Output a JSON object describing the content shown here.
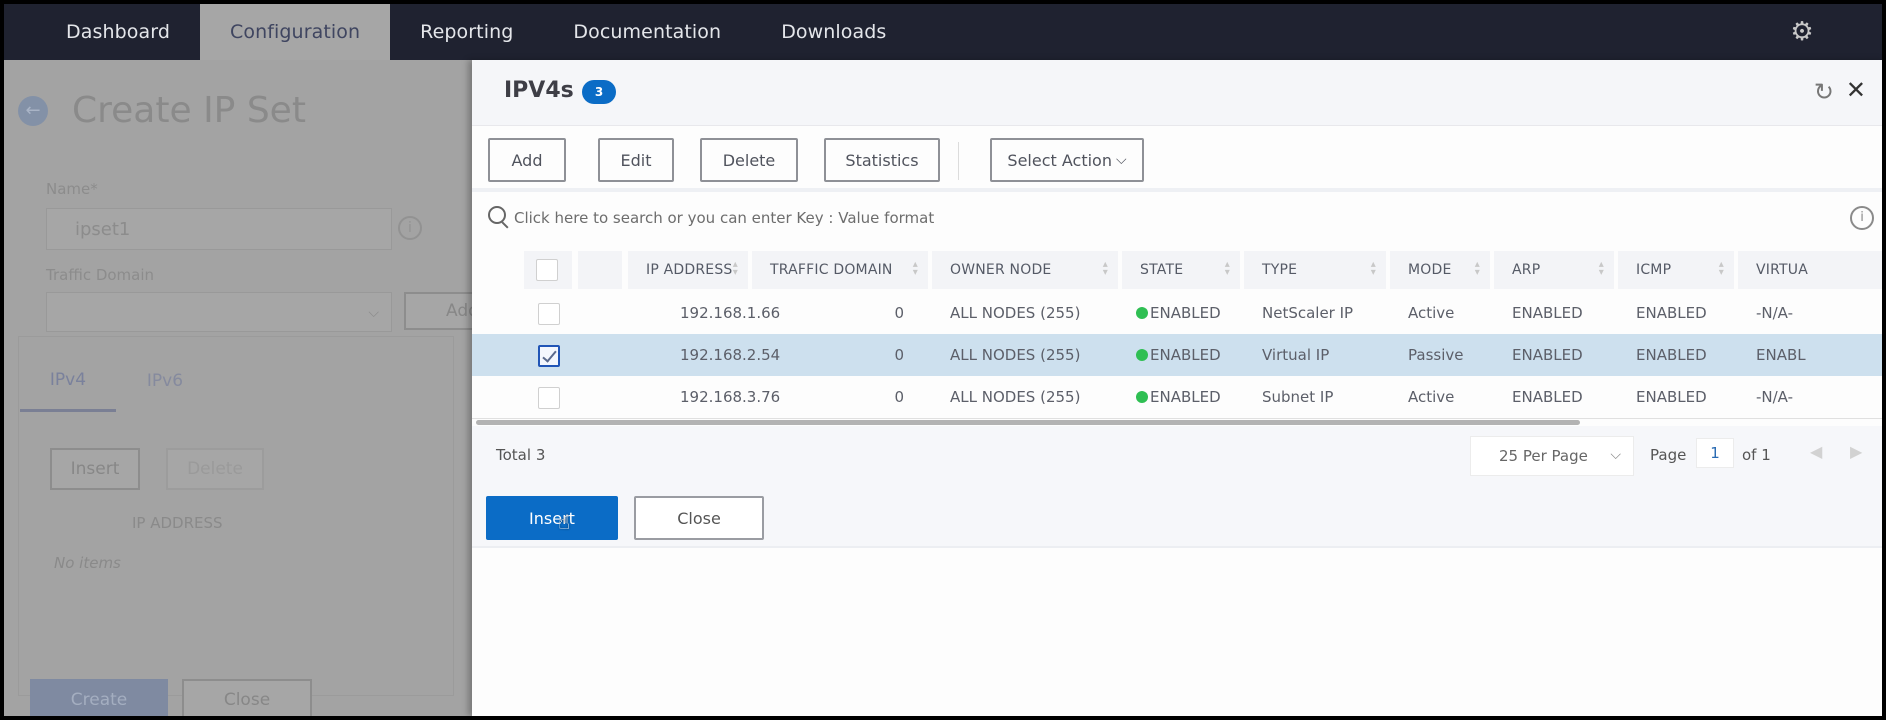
{
  "nav": {
    "tabs": [
      {
        "label": "Dashboard",
        "active": false
      },
      {
        "label": "Configuration",
        "active": true
      },
      {
        "label": "Reporting",
        "active": false
      },
      {
        "label": "Documentation",
        "active": false
      },
      {
        "label": "Downloads",
        "active": false
      }
    ],
    "settings_icon": "gear-icon"
  },
  "background_page": {
    "title": "Create IP Set",
    "back_icon": "arrow-left-icon",
    "name_label": "Name*",
    "name_value": "ipset1",
    "traffic_domain_label": "Traffic Domain",
    "traffic_domain_value": "",
    "add_button": "Add",
    "tabs": [
      {
        "label": "IPv4",
        "active": true
      },
      {
        "label": "IPv6",
        "active": false
      }
    ],
    "insert_button": "Insert",
    "delete_button": "Delete",
    "column_header": "IP ADDRESS",
    "empty_text": "No items",
    "create_button": "Create",
    "close_button": "Close"
  },
  "panel": {
    "title": "IPV4s",
    "count": "3",
    "refresh_icon": "refresh-icon",
    "close_icon": "close-icon",
    "toolbar": {
      "add": "Add",
      "edit": "Edit",
      "delete": "Delete",
      "statistics": "Statistics",
      "select_action": "Select Action"
    },
    "search_placeholder": "Click here to search or you can enter Key : Value format",
    "columns": [
      "IP ADDRESS",
      "TRAFFIC DOMAIN",
      "OWNER NODE",
      "STATE",
      "TYPE",
      "MODE",
      "ARP",
      "ICMP",
      "VIRTUA"
    ],
    "rows": [
      {
        "selected": false,
        "ip": "192.168.1.66",
        "traffic_domain": "0",
        "owner_node": "ALL NODES (255)",
        "state": "ENABLED",
        "type": "NetScaler IP",
        "mode": "Active",
        "arp": "ENABLED",
        "icmp": "ENABLED",
        "virtual": "-N/A-"
      },
      {
        "selected": true,
        "ip": "192.168.2.54",
        "traffic_domain": "0",
        "owner_node": "ALL NODES (255)",
        "state": "ENABLED",
        "type": "Virtual IP",
        "mode": "Passive",
        "arp": "ENABLED",
        "icmp": "ENABLED",
        "virtual": "ENABL"
      },
      {
        "selected": false,
        "ip": "192.168.3.76",
        "traffic_domain": "0",
        "owner_node": "ALL NODES (255)",
        "state": "ENABLED",
        "type": "Subnet IP",
        "mode": "Active",
        "arp": "ENABLED",
        "icmp": "ENABLED",
        "virtual": "-N/A-"
      }
    ],
    "footer": {
      "total_label": "Total",
      "total_value": "3",
      "per_page": "25 Per Page",
      "page_label": "Page",
      "page_value": "1",
      "page_of": "of 1"
    },
    "insert_button": "Insert",
    "close_button": "Close"
  },
  "colors": {
    "primary": "#0b6cc6",
    "nav_bg": "#1f2230",
    "selected_row": "#cde0ee",
    "status_enabled": "#2fbf53"
  }
}
